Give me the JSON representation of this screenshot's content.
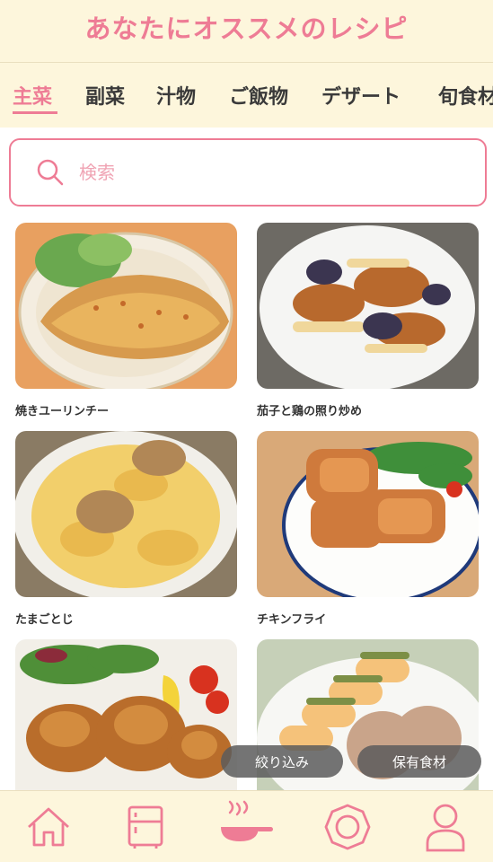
{
  "header": {
    "title": "あなたにオススメのレシピ"
  },
  "tabs": [
    {
      "label": "主菜",
      "active": true
    },
    {
      "label": "副菜"
    },
    {
      "label": "汁物"
    },
    {
      "label": "ご飯物"
    },
    {
      "label": "デザート"
    },
    {
      "label": "旬食材"
    }
  ],
  "search": {
    "placeholder": "検索",
    "value": ""
  },
  "recipes": [
    {
      "title": "焼きユーリンチー"
    },
    {
      "title": "茄子と鶏の照り炒め"
    },
    {
      "title": "たまごとじ"
    },
    {
      "title": "チキンフライ"
    },
    {
      "title": ""
    },
    {
      "title": ""
    }
  ],
  "actions": {
    "filter_label": "絞り込み",
    "pantry_label": "保有食材"
  },
  "bottom_nav": [
    {
      "icon": "home-icon"
    },
    {
      "icon": "fridge-icon"
    },
    {
      "icon": "pan-icon"
    },
    {
      "icon": "badge-icon"
    },
    {
      "icon": "user-icon"
    }
  ],
  "colors": {
    "accent": "#ee7c95",
    "header_bg": "#fdf6dc"
  }
}
